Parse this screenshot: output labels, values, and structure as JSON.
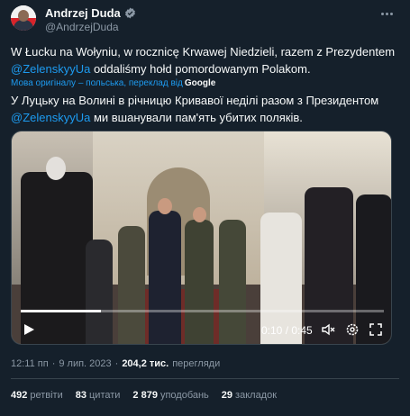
{
  "author": {
    "display_name": "Andrzej Duda",
    "handle": "@AndrzejDuda",
    "verified_icon": "verified-badge-icon"
  },
  "tweet": {
    "text_before_mention": "W Łucku na Wołyniu, w rocznicę Krwawej Niedzieli, razem z Prezydentem",
    "mention": "@ZelenskyyUa",
    "text_after_mention": " oddaliśmy hołd pomordowanym Polakom.",
    "translation_note": "Мова оригіналу – польська, переклад від",
    "translation_provider": "Google",
    "translated_before_mention": "У Луцьку на Волині в річницю Кривавої неділі разом з Президентом",
    "translated_mention": "@ZelenskyyUa",
    "translated_after_mention": " ми вшанували пам'ять убитих поляків."
  },
  "video": {
    "time_label": "0:10 / 0:45",
    "progress": 0.22,
    "controls": [
      "play-icon",
      "mute-icon",
      "settings-icon",
      "fullscreen-icon"
    ]
  },
  "meta": {
    "time": "12:11 пп",
    "separator": "·",
    "date": "9 лип. 2023",
    "views_count": "204,2 тис.",
    "views_label": "перегляди"
  },
  "stats": [
    {
      "count": "492",
      "label": "ретвіти"
    },
    {
      "count": "83",
      "label": "цитати"
    },
    {
      "count": "2 879",
      "label": "уподобань"
    },
    {
      "count": "29",
      "label": "закладок"
    }
  ],
  "colors": {
    "background": "#15202b",
    "accent": "#1d9bf0",
    "secondary_text": "#8b98a5",
    "border": "#38444d"
  }
}
